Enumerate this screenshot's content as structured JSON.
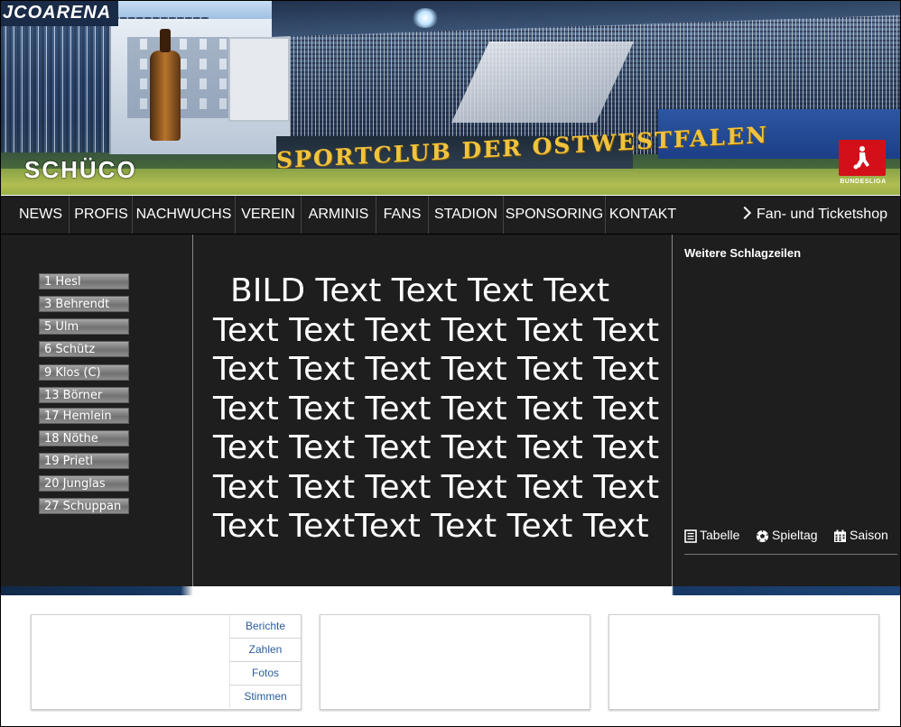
{
  "banner": {
    "arena_text": "JCOARENA",
    "sponsor_logo": "SCHÜCO",
    "stadium_banner": "SPORTCLUB DER OSTWESTFALEN",
    "league_logo": "BUNDESLIGA"
  },
  "nav": {
    "items": [
      "NEWS",
      "PROFIS",
      "NACHWUCHS",
      "VEREIN",
      "ARMINIS",
      "FANS",
      "STADION",
      "SPONSORING",
      "KONTAKT"
    ],
    "shop_label": "Fan- und Ticketshop"
  },
  "players": [
    "1 Hesl",
    "3 Behrendt",
    "5 Ulm",
    "6 Schütz",
    "9 Klos (C)",
    "13 Börner",
    "17 Hemlein",
    "18 Nöthe",
    "19 Prietl",
    "20 Junglas",
    "27 Schuppan"
  ],
  "article": {
    "lines": [
      "BILD   Text Text Text Text",
      "Text Text Text Text Text Text",
      "Text Text Text Text Text Text",
      "Text Text Text Text Text Text",
      "Text Text Text Text Text Text",
      "Text Text Text Text Text Text",
      "Text TextText Text Text Text"
    ]
  },
  "sidebar": {
    "title": "Weitere Schlagzeilen",
    "tools": [
      {
        "label": "Tabelle",
        "icon": "table-icon"
      },
      {
        "label": "Spieltag",
        "icon": "soccer-ball-icon"
      },
      {
        "label": "Saison",
        "icon": "calendar-icon"
      }
    ]
  },
  "bottom_box_1": {
    "links": [
      "Berichte",
      "Zahlen",
      "Fotos",
      "Stimmen"
    ]
  }
}
